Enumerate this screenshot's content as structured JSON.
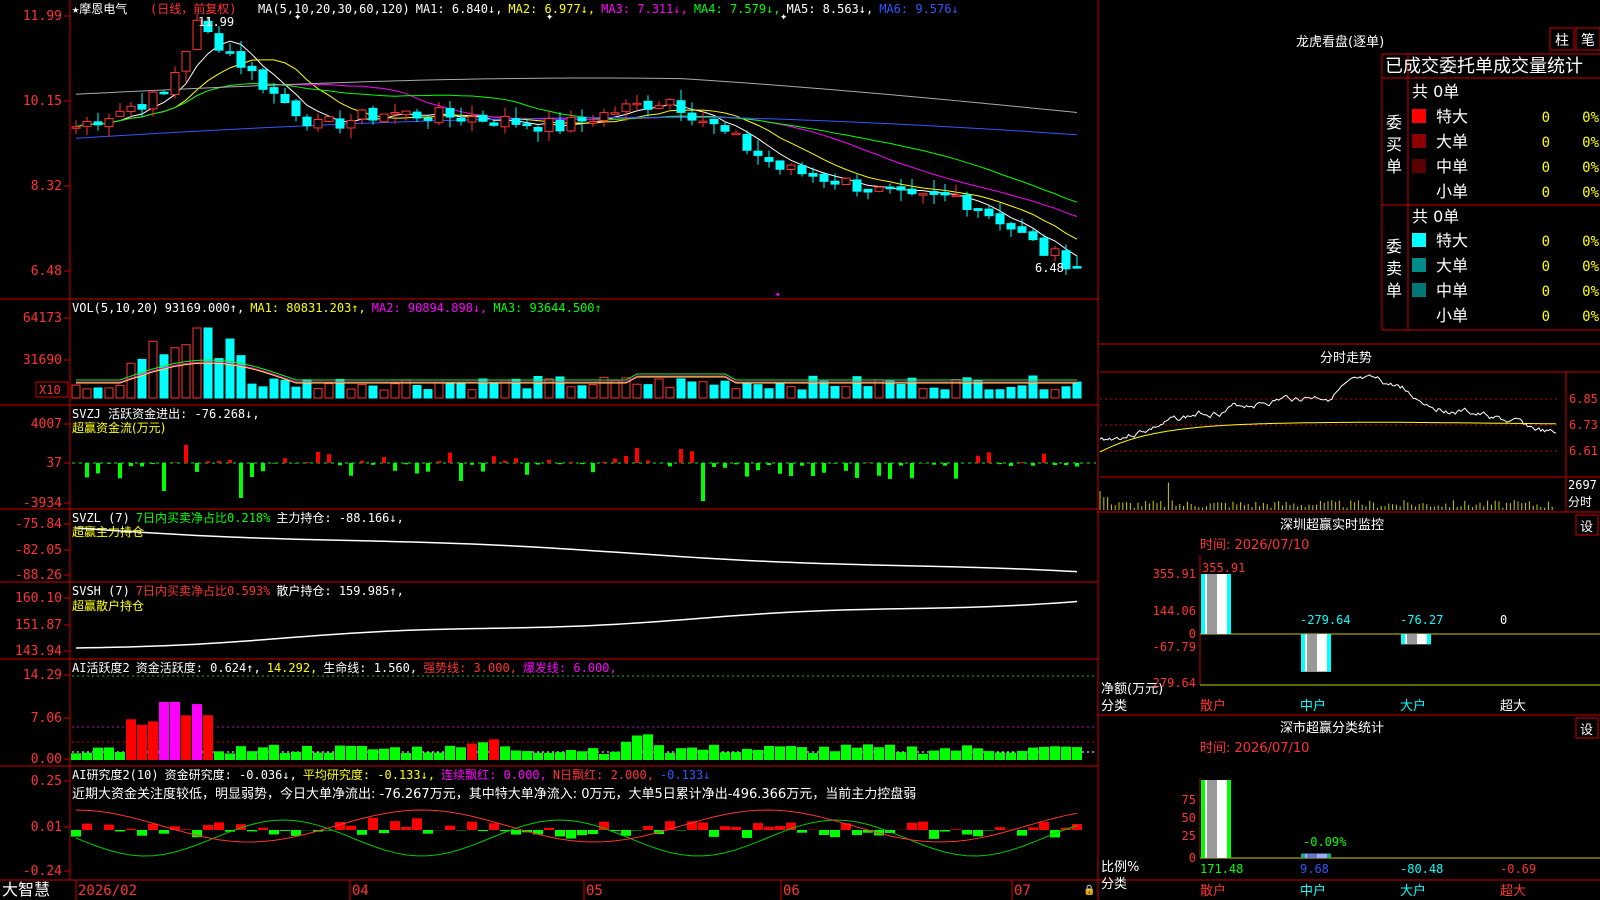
{
  "app": {
    "brand": "大智慧"
  },
  "stock": {
    "name": "★摩恩电气",
    "mode": "(日线，前复权)",
    "high_mark": "11.99",
    "low_mark": "6.48",
    "ma_line": [
      {
        "text": "MA(5,10,20,30,60,120)",
        "color": "#ffffff"
      },
      {
        "text": "MA1: 6.840↓,",
        "color": "#ffffff"
      },
      {
        "text": "MA2: 6.977↓,",
        "color": "#ffff00"
      },
      {
        "text": "MA3: 7.311↓,",
        "color": "#ff00ff"
      },
      {
        "text": "MA4: 7.579↓,",
        "color": "#00ff00"
      },
      {
        "text": "MA5: 8.563↓,",
        "color": "#ffffff"
      },
      {
        "text": "MA6: 9.576↓",
        "color": "#3355ff"
      }
    ],
    "price_ticks": [
      "11.99",
      "10.15",
      "8.32",
      "6.48"
    ]
  },
  "panes": {
    "vol": {
      "header": [
        {
          "text": "VOL(5,10,20)",
          "color": "#ffffff"
        },
        {
          "text": "93169.000↑,",
          "color": "#ffffff"
        },
        {
          "text": "MA1: 80831.203↑,",
          "color": "#ffff00"
        },
        {
          "text": "MA2: 90894.898↓,",
          "color": "#ff00ff"
        },
        {
          "text": "MA3: 93644.500↑",
          "color": "#00ff00"
        }
      ],
      "ticks": [
        "64173",
        "31690"
      ],
      "multiplier": "X10"
    },
    "svzj": {
      "header": [
        {
          "text": "SVZJ  活跃资金进出: -76.268↓,",
          "color": "#ffffff"
        }
      ],
      "subtitle": "超赢资金流(万元)",
      "ticks": [
        "4007",
        "37",
        "-3934"
      ]
    },
    "svzl": {
      "header": [
        {
          "text": "SVZL (7)",
          "color": "#ffffff"
        },
        {
          "text": "7日内买卖净占比0.218%",
          "color": "#00ff00"
        },
        {
          "text": "主力持仓: -88.166↓,",
          "color": "#ffffff"
        }
      ],
      "subtitle": "超赢主力持仓",
      "ticks": [
        "-75.84",
        "-82.05",
        "-88.26"
      ]
    },
    "svsh": {
      "header": [
        {
          "text": "SVSH (7)",
          "color": "#ffffff"
        },
        {
          "text": "7日内买卖净占比0.593%",
          "color": "#ff3333"
        },
        {
          "text": "散户持仓: 159.985↑,",
          "color": "#ffffff"
        }
      ],
      "subtitle": "超赢散户持仓",
      "ticks": [
        "160.10",
        "151.87",
        "143.94"
      ]
    },
    "ai1": {
      "header": [
        {
          "text": "AI活跃度2",
          "color": "#ffffff"
        },
        {
          "text": "资金活跃度: 0.624↑,",
          "color": "#ffffff"
        },
        {
          "text": "14.292,",
          "color": "#ffff00"
        },
        {
          "text": "生命线: 1.560,",
          "color": "#ffffff"
        },
        {
          "text": "强势线: 3.000,",
          "color": "#ff3333"
        },
        {
          "text": "爆发线: 6.000,",
          "color": "#ff00ff"
        }
      ],
      "ticks": [
        "14.29",
        "7.06",
        "0.00"
      ]
    },
    "ai2": {
      "header": [
        {
          "text": "AI研究度2(10)",
          "color": "#ffffff"
        },
        {
          "text": "资金研究度: -0.036↓,",
          "color": "#ffffff"
        },
        {
          "text": "平均研究度: -0.133↓,",
          "color": "#ffff00"
        },
        {
          "text": "连续飘红: 0.000,",
          "color": "#ff00ff"
        },
        {
          "text": "N日飘红: 2.000,",
          "color": "#ff3333"
        },
        {
          "text": "-0.133↓",
          "color": "#3355ff"
        }
      ],
      "comment": "近期大资金关注度较低，明显弱势，今日大单净流出: -76.267万元，其中特大单净流入: 0万元，大单5日累计净出-496.366万元，当前主力控盘弱",
      "ticks": [
        "0.25",
        "0.01",
        "-0.24"
      ]
    }
  },
  "xaxis": {
    "labels": [
      "2026/02",
      "04",
      "05",
      "06",
      "07"
    ]
  },
  "right": {
    "longhu": {
      "title": "龙虎看盘(逐单)",
      "btn_zhu": "柱",
      "btn_bi": "笔",
      "subtitle": "已成交委托单成交量统计",
      "buy_label": "委买单",
      "sell_label": "委卖单",
      "buy_total": "共 0单",
      "sell_total": "共 0单",
      "buy_rows": [
        {
          "label": "特大",
          "count": "0",
          "pct": "0%",
          "color": "#ff0000"
        },
        {
          "label": "大单",
          "count": "0",
          "pct": "0%",
          "color": "#8b0000"
        },
        {
          "label": "中单",
          "count": "0",
          "pct": "0%",
          "color": "#5a0000"
        },
        {
          "label": "小单",
          "count": "0",
          "pct": "0%",
          "color": ""
        }
      ],
      "sell_rows": [
        {
          "label": "特大",
          "count": "0",
          "pct": "0%",
          "color": "#00ffff"
        },
        {
          "label": "大单",
          "count": "0",
          "pct": "0%",
          "color": "#008b8b"
        },
        {
          "label": "中单",
          "count": "0",
          "pct": "0%",
          "color": "#007777"
        },
        {
          "label": "小单",
          "count": "0",
          "pct": "0%",
          "color": ""
        }
      ]
    },
    "intraday": {
      "title": "分时走势",
      "ticks": [
        "6.85",
        "6.73",
        "6.61"
      ],
      "vol_tick": "2697",
      "vol_label": "分时"
    },
    "monitor": {
      "title": "深圳超赢实时监控",
      "settings": "设",
      "time": "时间: 2026/07/10",
      "ticks": [
        "355.91",
        "144.06",
        "0",
        "-67.79",
        "-279.64"
      ],
      "bar_values": [
        {
          "cat": "散户",
          "value": 355.91,
          "label": "355.91"
        },
        {
          "cat": "中户",
          "value": -279.64,
          "label": "-279.64"
        },
        {
          "cat": "大户",
          "value": -76.27,
          "label": "-76.27"
        },
        {
          "cat": "超大",
          "value": 0,
          "label": "0"
        }
      ],
      "ylabel": "净额(万元)",
      "xlabel": "分类"
    },
    "classify": {
      "title": "深市超赢分类统计",
      "settings": "设",
      "time": "时间: 2026/07/10",
      "ticks": [
        "75",
        "50",
        "25",
        "0"
      ],
      "bar_values": [
        {
          "cat": "散户",
          "value": 171.48,
          "label": "171.48"
        },
        {
          "cat": "中户",
          "value": 9.68,
          "label": "9.68"
        },
        {
          "cat": "大户",
          "value": -80.48,
          "label": "-80.48"
        },
        {
          "cat": "超大",
          "value": -0.69,
          "label": "-0.69"
        }
      ],
      "mid_label": "-0.09%",
      "ylabel": "比例%",
      "xlabel": "分类"
    }
  }
}
